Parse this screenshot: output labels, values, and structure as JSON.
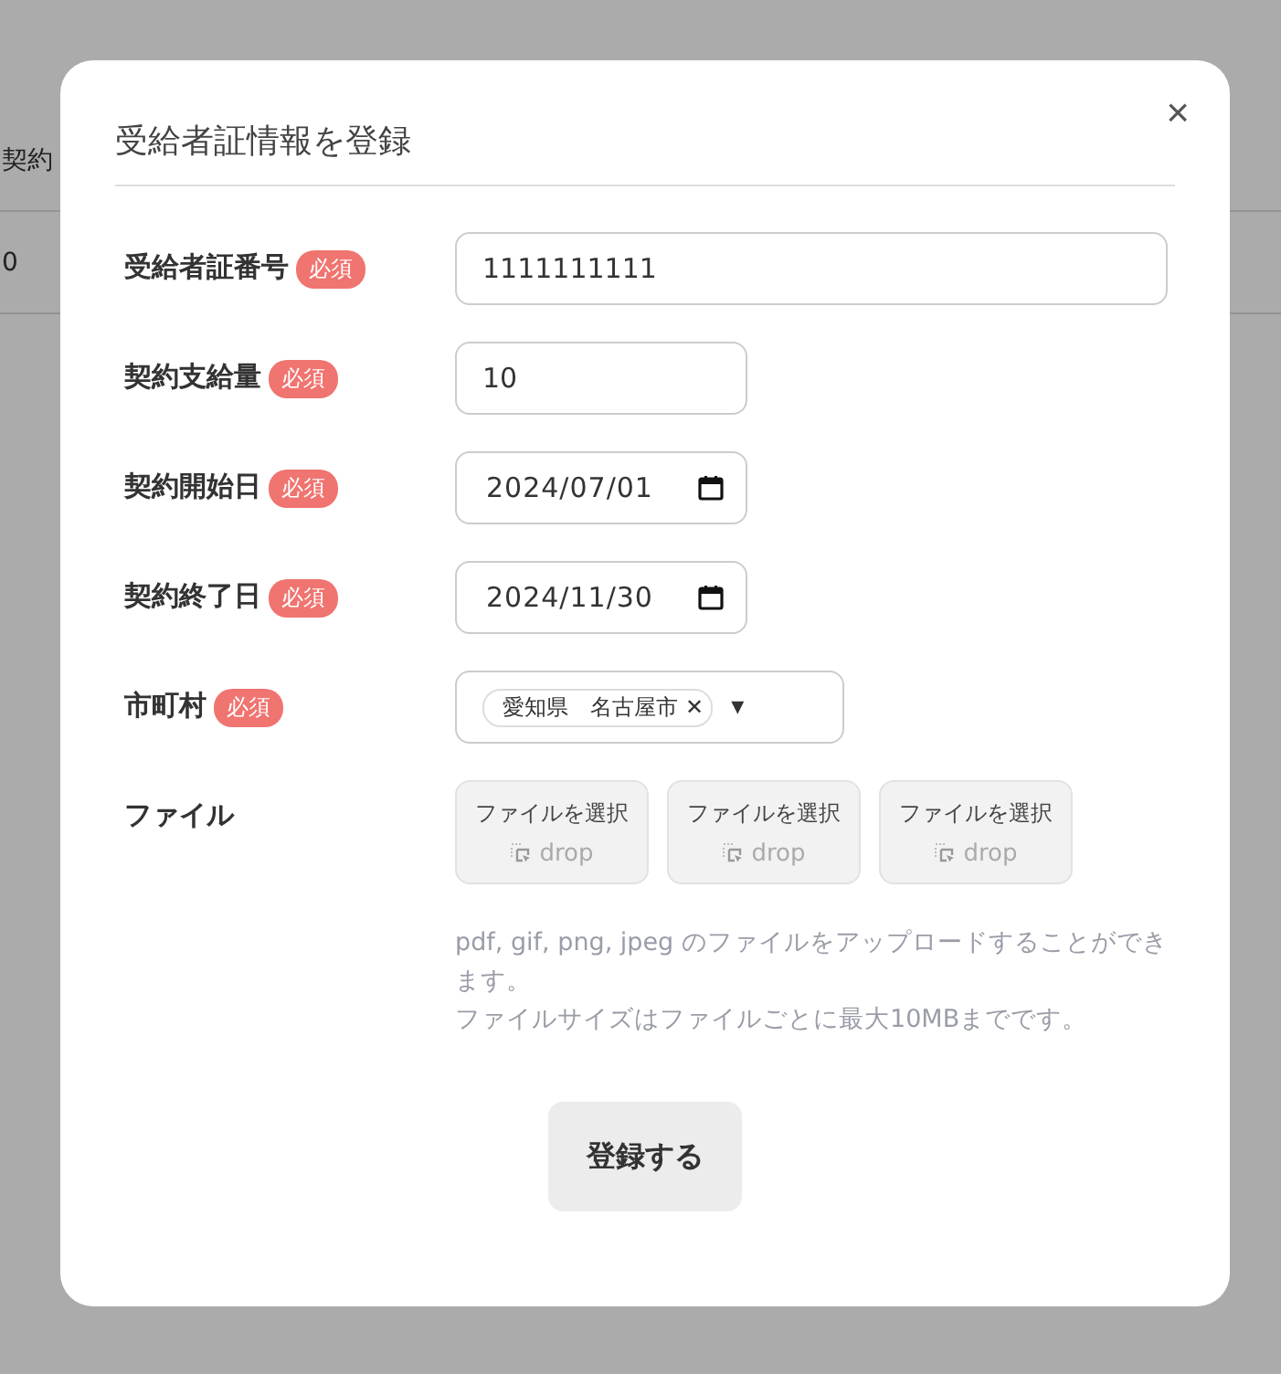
{
  "background": {
    "table_header": "契約",
    "table_cell": "0"
  },
  "dialog": {
    "title": "受給者証情報を登録",
    "close": "×",
    "fields": [
      {
        "kind": "text",
        "label": "受給者証番号",
        "required": true,
        "required_label": "必須",
        "value": "1111111111",
        "wide": true
      },
      {
        "kind": "text",
        "label": "契約支給量",
        "required": true,
        "required_label": "必須",
        "value": "10",
        "wide": false
      },
      {
        "kind": "date",
        "label": "契約開始日",
        "required": true,
        "required_label": "必須",
        "value": "2024/07/01"
      },
      {
        "kind": "date",
        "label": "契約終了日",
        "required": true,
        "required_label": "必須",
        "value": "2024/11/30"
      },
      {
        "kind": "select",
        "label": "市町村",
        "required": true,
        "required_label": "必須",
        "tags": [
          {
            "text": "愛知県　名古屋市",
            "remove": "✕"
          }
        ],
        "caret": "▾"
      },
      {
        "kind": "files",
        "label": "ファイル",
        "required": false,
        "slots": [
          {
            "button": "ファイルを選択",
            "drop": "drop"
          },
          {
            "button": "ファイルを選択",
            "drop": "drop"
          },
          {
            "button": "ファイルを選択",
            "drop": "drop"
          }
        ],
        "notes": [
          "pdf, gif, png, jpeg のファイルをアップロードすることができます。",
          "ファイルサイズはファイルごとに最大10MBまでです。"
        ]
      }
    ],
    "submit": "登録する"
  }
}
